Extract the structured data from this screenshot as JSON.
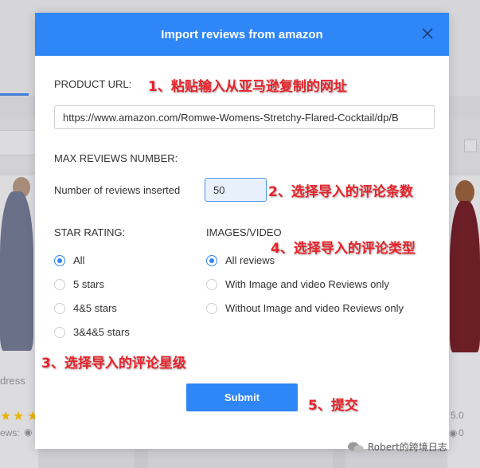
{
  "modal": {
    "title": "Import reviews from amazon",
    "product_url_label": "PRODUCT URL:",
    "product_url_value": "https://www.amazon.com/Romwe-Womens-Stretchy-Flared-Cocktail/dp/B",
    "max_reviews_label": "MAX REVIEWS NUMBER:",
    "num_reviews_label": "Number of reviews inserted",
    "num_reviews_value": "50",
    "star_rating_label": "STAR RATING:",
    "star_options": [
      "All",
      "5 stars",
      "4&5 stars",
      "3&4&5 stars"
    ],
    "star_selected": "All",
    "media_label": "IMAGES/VIDEO",
    "media_options": [
      "All reviews",
      "With Image and video Reviews only",
      "Without Image and video Reviews only"
    ],
    "media_selected": "All reviews",
    "submit_label": "Submit"
  },
  "annotations": {
    "step1": "1、粘贴输入从亚马逊复制的网址",
    "step2": "2、选择导入的评论条数",
    "step3": "3、选择导入的评论星级",
    "step4": "4、选择导入的评论类型",
    "step5": "5、提交"
  },
  "background": {
    "left_card_text": "dress",
    "left_card_reviews": "ews:",
    "right_card_rating": "5.0",
    "right_card_count": "0"
  },
  "watermark": {
    "text": "Robert的跨境日志"
  },
  "colors": {
    "primary": "#2f86f6",
    "annotation": "#e8222a"
  }
}
